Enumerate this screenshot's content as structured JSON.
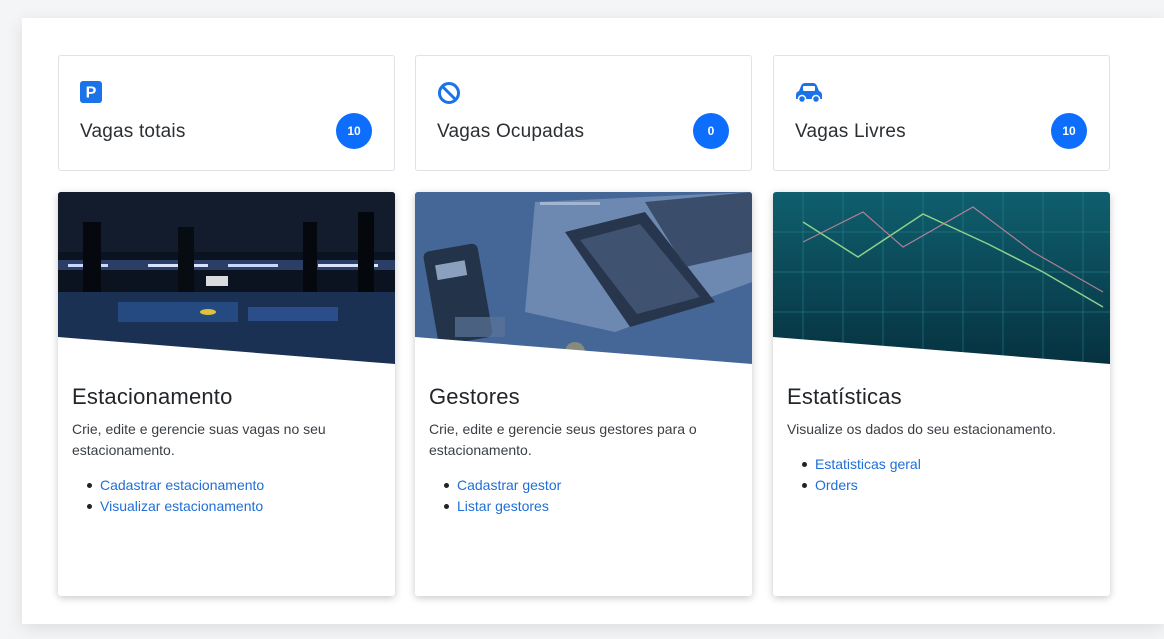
{
  "stats": [
    {
      "label": "Vagas totais",
      "value": "10",
      "icon": "parking-icon"
    },
    {
      "label": "Vagas Ocupadas",
      "value": "0",
      "icon": "ban-icon"
    },
    {
      "label": "Vagas Livres",
      "value": "10",
      "icon": "car-icon"
    }
  ],
  "stat_icon_letter": "P",
  "cards": [
    {
      "title": "Estacionamento",
      "text": "Crie, edite e gerencie suas vagas no seu estacionamento.",
      "links": [
        "Cadastrar estacionamento",
        "Visualizar estacionamento"
      ],
      "image": "parking-garage-image"
    },
    {
      "title": "Gestores",
      "text": "Crie, edite e gerencie seus gestores para o estacionamento.",
      "links": [
        "Cadastrar gestor",
        "Listar gestores"
      ],
      "image": "laptop-desk-image"
    },
    {
      "title": "Estatísticas",
      "text": "Visualize os dados do seu estacionamento.",
      "links": [
        "Estatisticas geral",
        "Orders"
      ],
      "image": "line-chart-image"
    }
  ],
  "colors": {
    "accent": "#0d6efd",
    "link": "#1f6fd6",
    "icon_blue": "#1a73e8"
  }
}
